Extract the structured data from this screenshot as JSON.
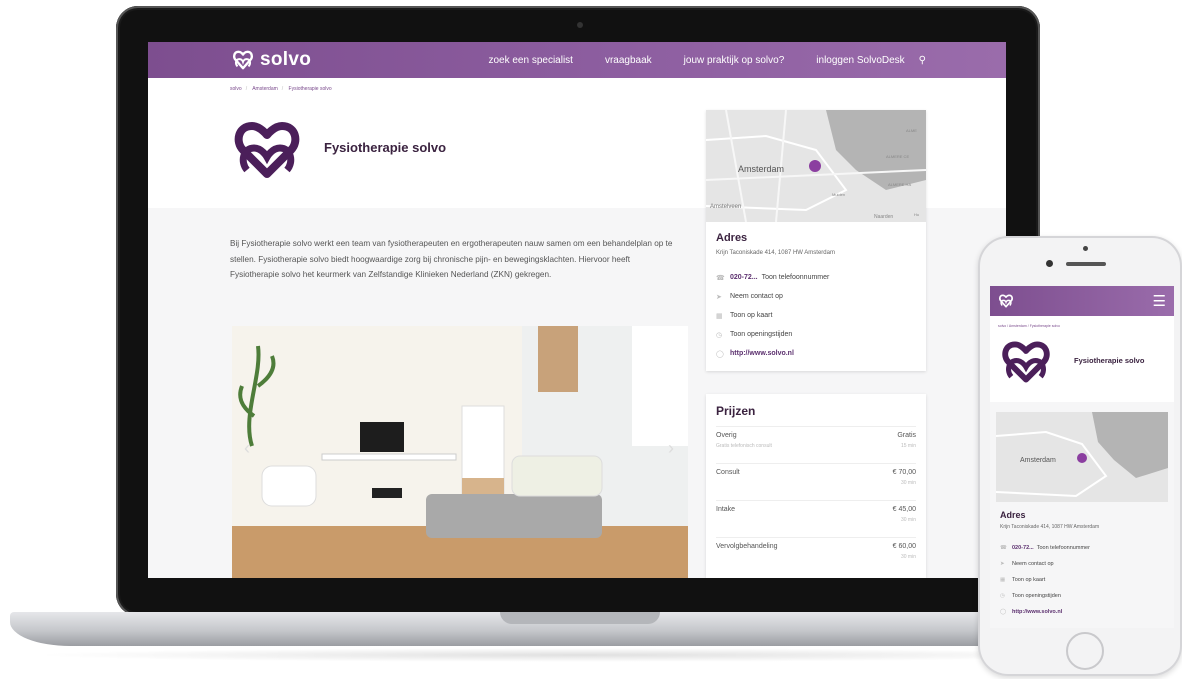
{
  "site": {
    "brand": "solvo",
    "nav": [
      "zoek een specialist",
      "vraagbaak",
      "jouw praktijk op solvo?",
      "inloggen SolvoDesk"
    ],
    "breadcrumb": [
      "solvo",
      "Amsterdam",
      "Fysiotherapie solvo"
    ]
  },
  "practice": {
    "title": "Fysiotherapie solvo",
    "intro": "Bij Fysiotherapie solvo werkt een team van fysiotherapeuten en ergotherapeuten nauw samen om een behandelplan op te stellen. Fysiotherapie solvo biedt hoogwaardige zorg bij chronische pijn- en bewegingsklachten. Hiervoor heeft Fysiotherapie solvo het keurmerk van Zelfstandige Klinieken Nederland (ZKN) gekregen."
  },
  "map": {
    "city": "Amsterdam",
    "nearby": "Amstelveen",
    "labels": [
      "ALME",
      "ALMERE CE",
      "ALMERE HA",
      "Muiden",
      "Naarden",
      "Hu"
    ]
  },
  "address": {
    "heading": "Adres",
    "street": "Krijn Taconiskade 414, 1087 HW Amsterdam",
    "phone": "020-72...",
    "phone_action": "Toon telefoonnummer",
    "contact": "Neem contact op",
    "map_link": "Toon op kaart",
    "hours": "Toon openingstijden",
    "website": "http://www.solvo.nl"
  },
  "prices": {
    "heading": "Prijzen",
    "rows": [
      {
        "name": "Overig",
        "sub": "Gratis telefonisch consult",
        "value": "Gratis",
        "duration": "15 min"
      },
      {
        "name": "Consult",
        "sub": "",
        "value": "€ 70,00",
        "duration": "30 min"
      },
      {
        "name": "Intake",
        "sub": "",
        "value": "€ 45,00",
        "duration": "30 min"
      },
      {
        "name": "Vervolgbehandeling",
        "sub": "",
        "value": "€ 60,00",
        "duration": "30 min"
      }
    ]
  },
  "colors": {
    "brand_purple": "#7d4e8f",
    "brand_dark": "#5b2f6e",
    "title": "#3b2340"
  },
  "icons": [
    "search-icon",
    "phone-icon",
    "send-icon",
    "map-icon",
    "clock-icon",
    "globe-icon",
    "menu-icon",
    "chevron-left-icon",
    "chevron-right-icon"
  ]
}
